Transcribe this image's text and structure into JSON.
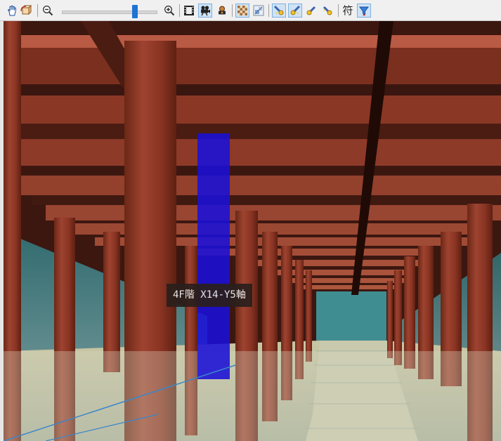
{
  "toolbar": {
    "tools": [
      {
        "name": "pan-hand-icon"
      },
      {
        "name": "rotate-orbit-icon"
      },
      {
        "name": "zoom-out-icon"
      },
      {
        "name": "zoom-slider"
      },
      {
        "name": "zoom-in-icon"
      },
      {
        "name": "film-frame-icon"
      },
      {
        "name": "movie-camera-icon"
      },
      {
        "name": "walkthrough-person-icon"
      },
      {
        "name": "texture-checker-icon"
      },
      {
        "name": "section-view-icon"
      },
      {
        "name": "light-1-icon"
      },
      {
        "name": "light-2-icon"
      },
      {
        "name": "light-3-icon"
      },
      {
        "name": "light-4-icon"
      },
      {
        "name": "symbol-label-icon"
      },
      {
        "name": "filter-funnel-icon"
      }
    ],
    "symbol_glyph": "符",
    "zoom_level": 0.78
  },
  "viewport": {
    "tooltip": "4F階 X14-Y5軸",
    "highlight_color": "#1a10d8",
    "steel_color": "#8e3a28",
    "floor_color": "#b9b89a",
    "back_wall_color": "#3d8a8f"
  }
}
